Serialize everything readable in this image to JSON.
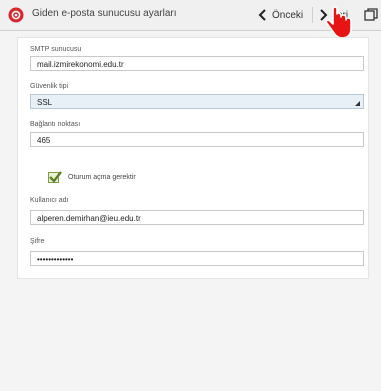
{
  "header": {
    "title": "Giden e-posta sunucusu ayarları",
    "prev_label": "Önceki",
    "next_label": "İleri",
    "app_icon": "email-app-icon",
    "window_icon": "window-icon"
  },
  "form": {
    "smtp_label": "SMTP sunucusu",
    "smtp_value": "mail.izmirekonomi.edu.tr",
    "security_label": "Güvenlik tipi",
    "security_value": "SSL",
    "port_label": "Bağlantı noktası",
    "port_value": "465",
    "login_label": "Oturum açma gerektir",
    "login_checked": true,
    "username_label": "Kullanıcı adı",
    "username_value": "alperen.demirhan@ieu.edu.tr",
    "password_label": "Şifre",
    "password_value": "•••••••••••••"
  },
  "colors": {
    "accent": "#d9262c",
    "checkbox": "#7e9b4a",
    "select_bg": "#e8f0f7"
  }
}
